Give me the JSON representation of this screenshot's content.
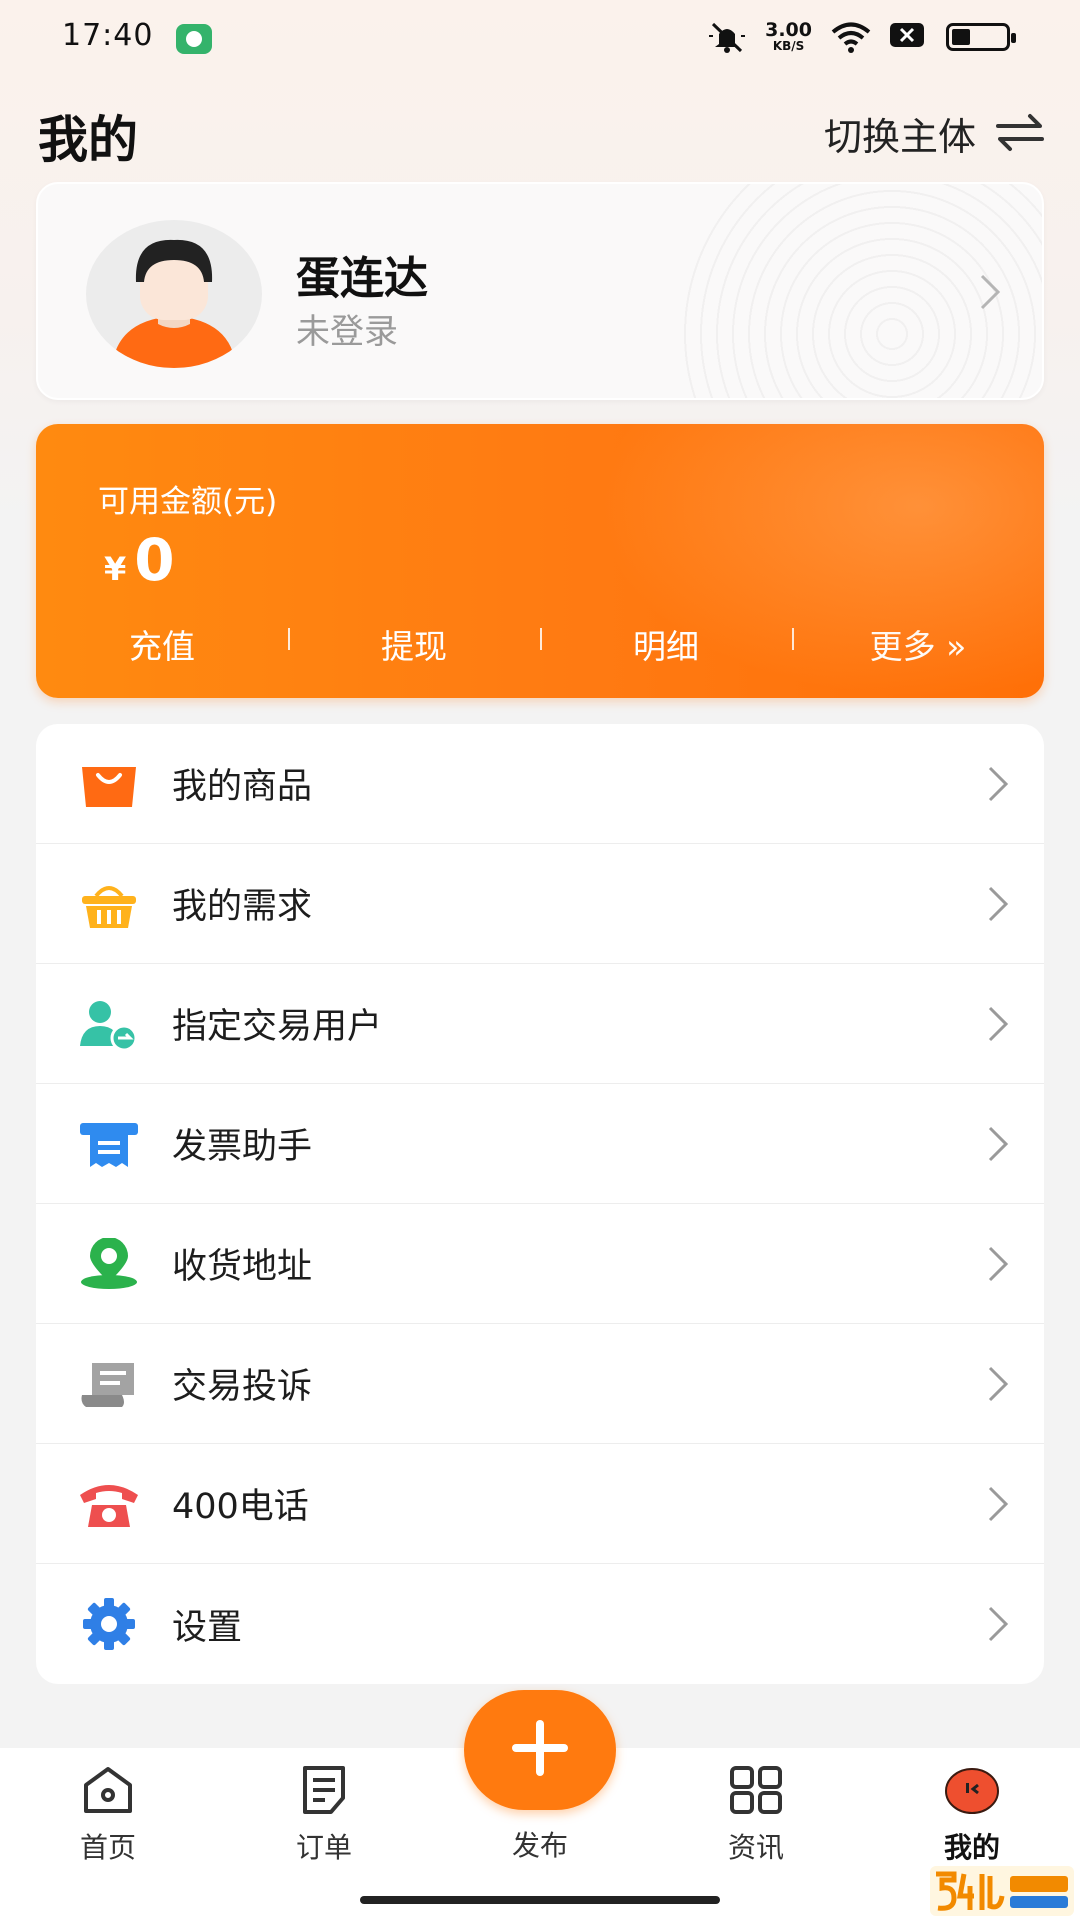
{
  "status_bar": {
    "time": "17:40",
    "network_speed_value": "3.00",
    "network_speed_unit": "KB/S",
    "icons": [
      "app-badge-icon",
      "mute-icon",
      "wifi-icon",
      "sim-off-icon",
      "battery-icon"
    ]
  },
  "header": {
    "title": "我的",
    "switch_label": "切换主体"
  },
  "profile": {
    "name": "蛋连达",
    "status": "未登录"
  },
  "wallet": {
    "label": "可用金额(元)",
    "currency": "¥",
    "amount": "0",
    "actions": [
      {
        "label": "充值"
      },
      {
        "label": "提现"
      },
      {
        "label": "明细"
      },
      {
        "label": "更多 »"
      }
    ]
  },
  "menu": [
    {
      "label": "我的商品",
      "icon": "shopping-bag-icon",
      "color": "#ff6a13"
    },
    {
      "label": "我的需求",
      "icon": "basket-icon",
      "color": "#ffb21c"
    },
    {
      "label": "指定交易用户",
      "icon": "user-transfer-icon",
      "color": "#36c2a6"
    },
    {
      "label": "发票助手",
      "icon": "invoice-icon",
      "color": "#2f8bef"
    },
    {
      "label": "收货地址",
      "icon": "location-icon",
      "color": "#2bb24c"
    },
    {
      "label": "交易投诉",
      "icon": "complaint-scroll-icon",
      "color": "#9a9a9a"
    },
    {
      "label": "400电话",
      "icon": "telephone-icon",
      "color": "#ee4f4f"
    },
    {
      "label": "设置",
      "icon": "gear-icon",
      "color": "#2f7fe6"
    }
  ],
  "bottom_nav": {
    "items": [
      {
        "label": "首页",
        "icon": "home-icon"
      },
      {
        "label": "订单",
        "icon": "order-icon"
      },
      {
        "label": "发布",
        "icon": "plus-icon"
      },
      {
        "label": "资讯",
        "icon": "grid-icon"
      },
      {
        "label": "我的",
        "icon": "profile-icon",
        "active": true
      }
    ],
    "accent": "#ff7a0f"
  }
}
